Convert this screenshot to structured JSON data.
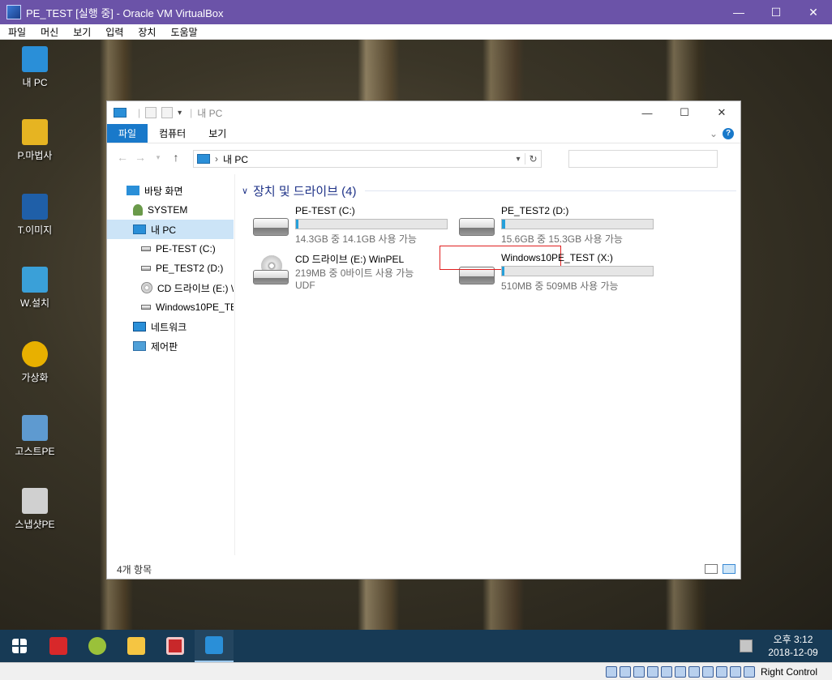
{
  "vbox": {
    "title": "PE_TEST [실행 중] - Oracle VM VirtualBox",
    "menu": [
      "파일",
      "머신",
      "보기",
      "입력",
      "장치",
      "도움말"
    ],
    "controls": {
      "minimize": "—",
      "maximize": "☐",
      "close": "✕"
    },
    "host_key": "Right Control"
  },
  "desktop": {
    "icons": [
      {
        "label": "내 PC",
        "color": "#2a8fd8"
      },
      {
        "label": "P.마법사",
        "color": "#e6b422"
      },
      {
        "label": "T.이미지",
        "color": "#1f5fa8"
      },
      {
        "label": "W.설치",
        "color": "#3aa0d8"
      },
      {
        "label": "가상화",
        "color": "#e8b000"
      },
      {
        "label": "고스트PE",
        "color": "#5e9ad0"
      },
      {
        "label": "스냅샷PE",
        "color": "#d0d0d0"
      }
    ]
  },
  "explorer": {
    "title": "내 PC",
    "tabs": {
      "file": "파일",
      "computer": "컴퓨터",
      "view": "보기"
    },
    "help": "?",
    "address": {
      "location": "내 PC"
    },
    "nav": {
      "desktop": "바탕 화면",
      "system": "SYSTEM",
      "this_pc": "내 PC",
      "drive_c": "PE-TEST (C:)",
      "drive_d": "PE_TEST2 (D:)",
      "drive_e": "CD 드라이브 (E:) \\",
      "drive_x": "Windows10PE_TES",
      "network": "네트워크",
      "control_panel": "제어판"
    },
    "group": {
      "title": "장치 및 드라이브 (4)"
    },
    "drives": [
      {
        "name": "PE-TEST (C:)",
        "free": "14.3GB 중 14.1GB 사용 가능",
        "used_fraction": 0.014
      },
      {
        "name": "PE_TEST2 (D:)",
        "free": "15.6GB 중 15.3GB 사용 가능",
        "used_fraction": 0.019
      },
      {
        "name": "CD 드라이브 (E:) WinPEL",
        "free": "219MB 중 0바이트 사용 가능",
        "fs": "UDF"
      },
      {
        "name": "Windows10PE_TEST (X:)",
        "free": "510MB 중 509MB 사용 가능",
        "used_fraction": 0.002
      }
    ],
    "status": {
      "count": "4개 항목"
    }
  },
  "taskbar": {
    "clock": {
      "time": "오후 3:12",
      "date": "2018-12-09"
    }
  }
}
